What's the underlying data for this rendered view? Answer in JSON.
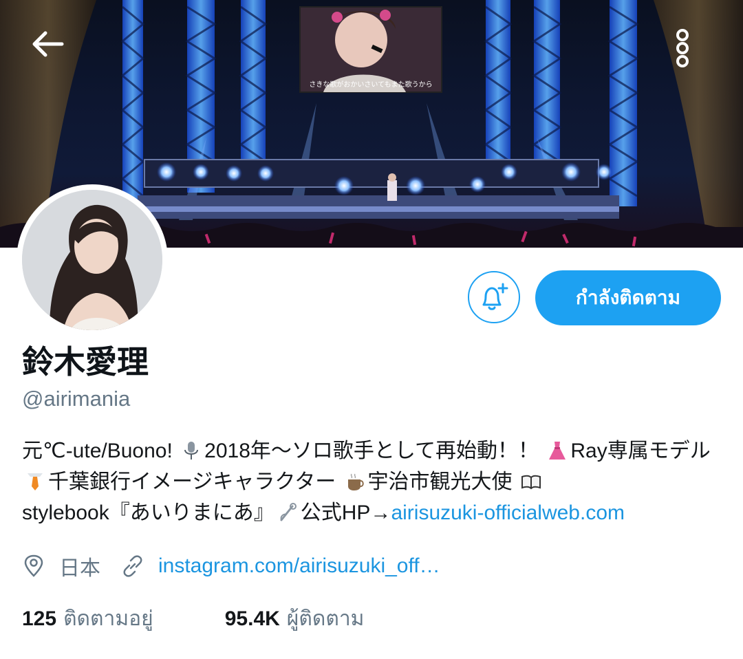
{
  "header": {
    "back_icon": "arrow-left-icon",
    "more_icon": "more-vertical-icon",
    "banner_subtitle": "さきな歌がおかいさいてもまた歌うから"
  },
  "profile": {
    "display_name": "鈴木愛理",
    "handle": "@airimania",
    "bio": {
      "part1": "元℃-ute/Buono!",
      "part2": "2018年〜ソロ歌手として再始動！！",
      "part3": "Ray専属モデル",
      "part4": "千葉銀行イメージキャラクター",
      "part5": "宇治市観光大使",
      "part6": "stylebook『あいりまにあ』",
      "part7": "公式HP→",
      "link": "airisuzuki-officialweb.com"
    },
    "location": "日本",
    "website": "instagram.com/airisuzuki_off…",
    "following_count": "125",
    "following_label": "ติดตามอยู่",
    "followers_count": "95.4K",
    "followers_label": "ผู้ติดตาม"
  },
  "actions": {
    "follow_label": "กำลังติดตาม",
    "bell_icon": "bell-plus-icon"
  },
  "colors": {
    "accent": "#1da1f2",
    "link": "#1b95e0",
    "secondary_text": "#657786"
  }
}
